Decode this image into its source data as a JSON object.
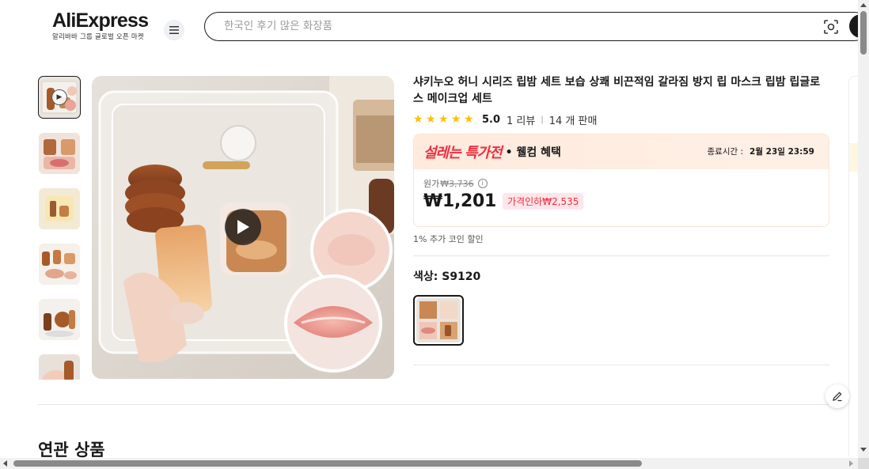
{
  "header": {
    "logo": "AliExpress",
    "logo_sub": "알리바바 그룹 글로벌 오픈 마켓",
    "search_placeholder": "한국인 후기 많은 화장품"
  },
  "product": {
    "title": "샤키누오 허니 시리즈 립밤 세트 보습 상쾌 비끈적임 갈라짐 방지 립 마스크 립밤 립글로스 메이크업 세트",
    "rating": "5.0",
    "reviews": "1 리뷰",
    "separator": "|",
    "sold": "14 개 판매",
    "stars": 5
  },
  "promo": {
    "logo": "설레는 특가전",
    "subtitle": "• 웰컴 혜택",
    "end_label": "종료시간 :",
    "end_time": "2월 23일 23:59"
  },
  "price": {
    "original_label": "원가",
    "original": "₩3,736",
    "current": "₩1,201",
    "discount": "가격인하₩2,535",
    "coin": "1% 추가 코인 할인"
  },
  "variant": {
    "color_label": "색상: S9120"
  },
  "sections": {
    "related": "연관 상품"
  },
  "colors": {
    "accent_red": "#f12d3d",
    "star": "#fdc000"
  }
}
